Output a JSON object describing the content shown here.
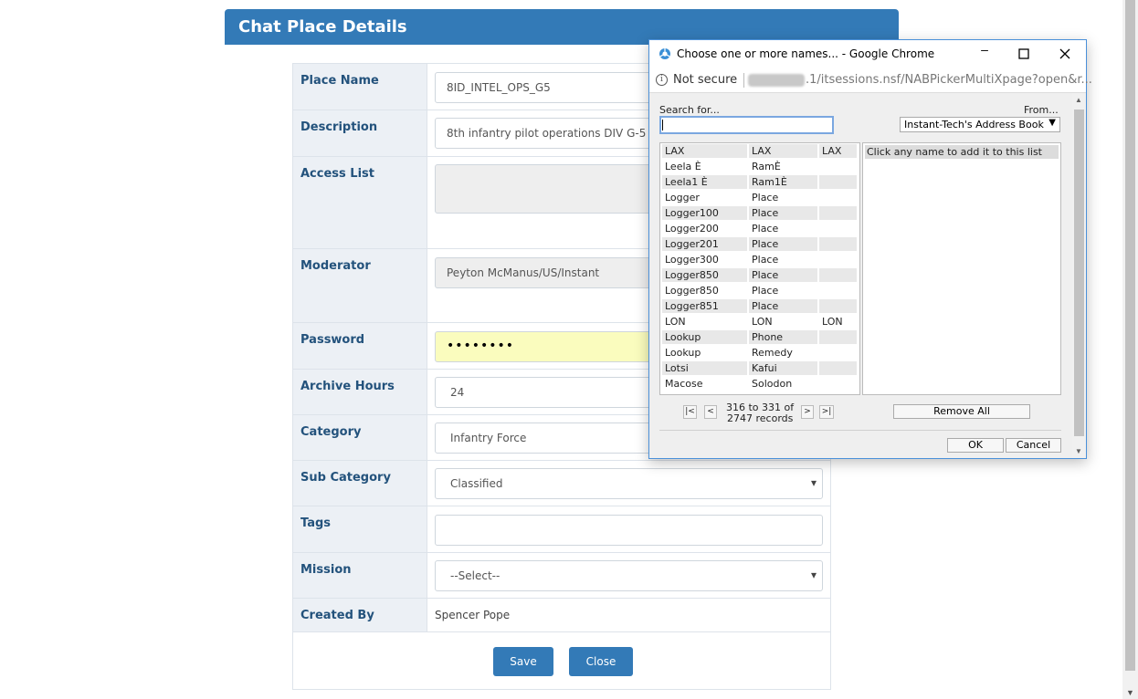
{
  "page": {
    "title": "Chat Place Details"
  },
  "form": {
    "place_name": {
      "label": "Place Name",
      "value": "8ID_INTEL_OPS_G5"
    },
    "description": {
      "label": "Description",
      "value": "8th infantry pilot operations DIV G-5"
    },
    "access_list": {
      "label": "Access List",
      "value": ""
    },
    "moderator": {
      "label": "Moderator",
      "value": "Peyton McManus/US/Instant"
    },
    "password": {
      "label": "Password",
      "value": "••••••••"
    },
    "archive_hours": {
      "label": "Archive Hours",
      "value": "24"
    },
    "category": {
      "label": "Category",
      "value": "Infantry Force"
    },
    "sub_category": {
      "label": "Sub Category",
      "value": "Classified"
    },
    "tags": {
      "label": "Tags",
      "value": ""
    },
    "mission": {
      "label": "Mission",
      "value": "--Select--"
    },
    "created_by": {
      "label": "Created By",
      "value": "Spencer Pope"
    },
    "save_label": "Save",
    "close_label": "Close"
  },
  "popup": {
    "window_title": "Choose one or more names... - Google Chrome",
    "not_secure": "Not secure",
    "url": ".1/itsessions.nsf/NABPickerMultiXpage?open&r...",
    "search_label": "Search for...",
    "search_value": "",
    "from_label": "From...",
    "from_value": "Instant-Tech's Address Book",
    "names": [
      [
        "LAX",
        "LAX",
        "LAX"
      ],
      [
        "Leela È",
        "RamÈ",
        ""
      ],
      [
        "Leela1 È",
        "Ram1È",
        ""
      ],
      [
        "Logger",
        "Place",
        ""
      ],
      [
        "Logger100",
        "Place",
        ""
      ],
      [
        "Logger200",
        "Place",
        ""
      ],
      [
        "Logger201",
        "Place",
        ""
      ],
      [
        "Logger300",
        "Place",
        ""
      ],
      [
        "Logger850",
        "Place",
        ""
      ],
      [
        "Logger850",
        "Place",
        ""
      ],
      [
        "Logger851",
        "Place",
        ""
      ],
      [
        "LON",
        "LON",
        "LON"
      ],
      [
        "Lookup",
        "Phone",
        ""
      ],
      [
        "Lookup",
        "Remedy",
        ""
      ],
      [
        "Lotsi",
        "Kafui",
        ""
      ],
      [
        "Macose",
        "Solodon",
        ""
      ]
    ],
    "selected_hint": "Click any name to add it to this list",
    "nav_first": "|<",
    "nav_prev": "<",
    "nav_next": ">",
    "nav_last": ">|",
    "records_line1": "316 to 331 of",
    "records_line2": "2747 records",
    "remove_all": "Remove All",
    "ok": "OK",
    "cancel": "Cancel"
  }
}
